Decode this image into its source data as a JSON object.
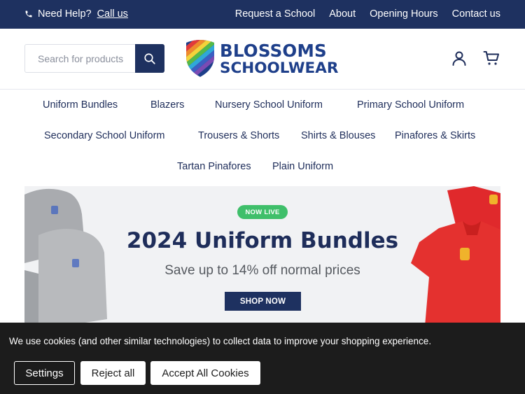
{
  "topbar": {
    "help_label": "Need Help?",
    "call_label": "Call us",
    "links": [
      "Request a School",
      "About",
      "Opening Hours",
      "Contact us"
    ]
  },
  "header": {
    "search_placeholder": "Search for products",
    "logo_line1": "BLOSSOMS",
    "logo_line2": "SCHOOLWEAR"
  },
  "nav": {
    "items": [
      "Uniform Bundles",
      "Blazers",
      "Nursery School Uniform",
      "Primary School Uniform",
      "Secondary School Uniform",
      "Trousers & Shorts",
      "Shirts & Blouses",
      "Pinafores & Skirts",
      "Tartan Pinafores",
      "Plain Uniform"
    ]
  },
  "banner": {
    "badge": "NOW LIVE",
    "title": "2024 Uniform Bundles",
    "subtitle": "Save up to 14% off normal prices",
    "button": "SHOP NOW"
  },
  "cookie": {
    "message": "We use cookies (and other similar technologies) to collect data to improve your shopping experience.",
    "settings": "Settings",
    "reject": "Reject all",
    "accept": "Accept All Cookies"
  },
  "colors": {
    "navy": "#1e3160",
    "brand_blue": "#1e3f8a",
    "badge_green": "#3fbf6a",
    "cookie_bg": "#1c1c1c"
  },
  "icons": [
    "phone-icon",
    "search-icon",
    "account-icon",
    "cart-icon"
  ]
}
